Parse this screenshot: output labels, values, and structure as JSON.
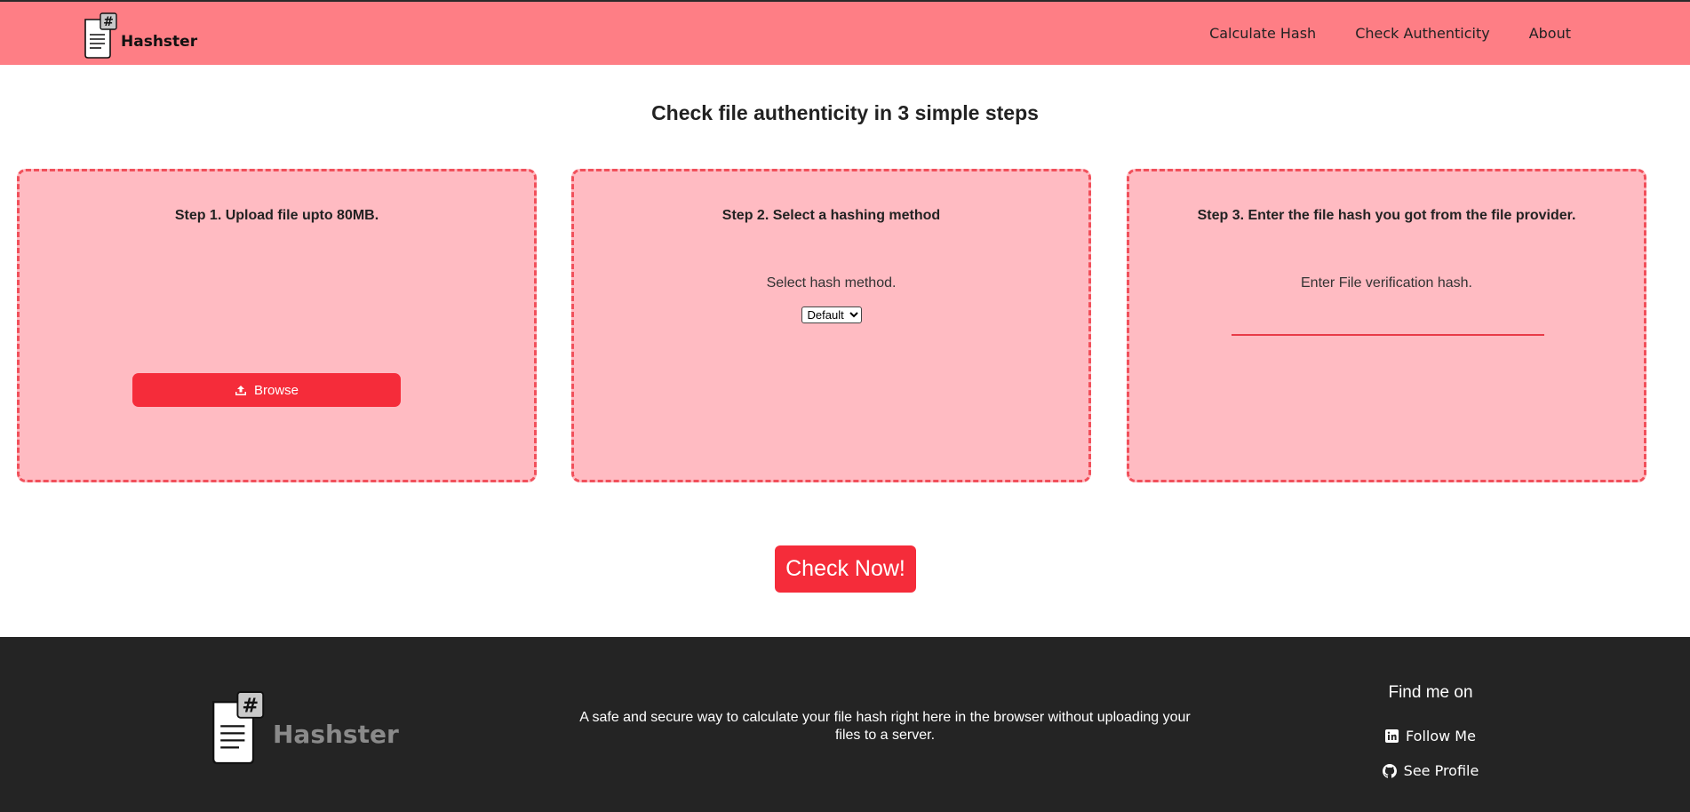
{
  "brand": {
    "name": "Hashster",
    "logo_icon": "hash-document-icon"
  },
  "nav": {
    "items": [
      "Calculate Hash",
      "Check Authenticity",
      "About"
    ]
  },
  "main": {
    "heading": "Check file authenticity in 3 simple steps",
    "steps": [
      {
        "title": "Step 1. Upload file upto 80MB.",
        "button_label": "Browse",
        "button_icon": "upload-icon"
      },
      {
        "title": "Step 2. Select a hashing method",
        "subtitle": "Select hash method.",
        "select_value": "Default"
      },
      {
        "title": "Step 3. Enter the file hash you got from the file provider.",
        "subtitle": "Enter File verification hash.",
        "input_value": ""
      }
    ],
    "check_button": "Check Now!"
  },
  "footer": {
    "brand_name": "Hashster",
    "description": "A safe and secure way to calculate your file hash right here in the browser without uploading your files to a server.",
    "find_me_title": "Find me on",
    "links": [
      {
        "label": "Follow Me",
        "icon": "linkedin-icon"
      },
      {
        "label": "See Profile",
        "icon": "github-icon"
      }
    ]
  },
  "colors": {
    "navbar": "#fe7e85",
    "card_background": "#ffbbc2",
    "card_border": "#f1505b",
    "accent": "#f52c3a",
    "footer": "#242424"
  }
}
